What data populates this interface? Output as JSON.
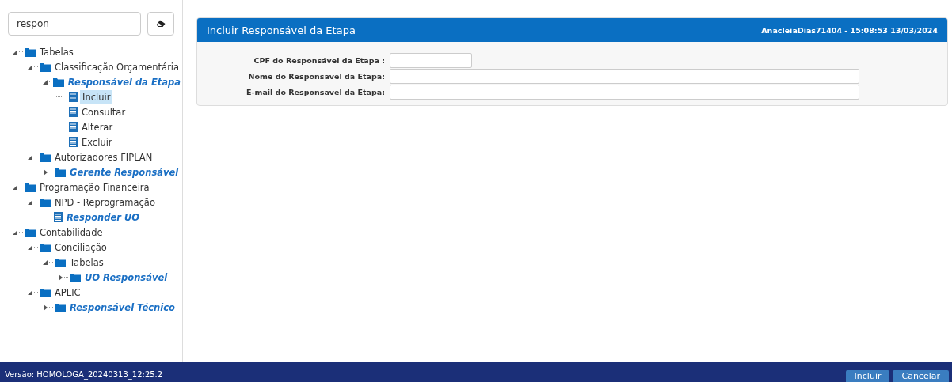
{
  "sidebar": {
    "search": {
      "value": "respon"
    },
    "tree": [
      {
        "label": "Tabelas",
        "kind": "folder",
        "expanded": true,
        "match": false,
        "selected": false,
        "children": [
          {
            "label": "Classificação Orçamentária",
            "kind": "folder",
            "expanded": true,
            "match": false,
            "selected": false,
            "children": [
              {
                "label": "Responsável da Etapa",
                "kind": "folder",
                "expanded": true,
                "match": true,
                "selected": false,
                "children": [
                  {
                    "label": "Incluir",
                    "kind": "page",
                    "match": false,
                    "selected": true
                  },
                  {
                    "label": "Consultar",
                    "kind": "page",
                    "match": false,
                    "selected": false
                  },
                  {
                    "label": "Alterar",
                    "kind": "page",
                    "match": false,
                    "selected": false
                  },
                  {
                    "label": "Excluir",
                    "kind": "page",
                    "match": false,
                    "selected": false
                  }
                ]
              }
            ]
          },
          {
            "label": "Autorizadores FIPLAN",
            "kind": "folder",
            "expanded": true,
            "match": false,
            "selected": false,
            "children": [
              {
                "label": "Gerente Responsável",
                "kind": "folder",
                "expanded": false,
                "match": true,
                "selected": false
              }
            ]
          }
        ]
      },
      {
        "label": "Programação Financeira",
        "kind": "folder",
        "expanded": true,
        "match": false,
        "selected": false,
        "children": [
          {
            "label": "NPD - Reprogramação",
            "kind": "folder",
            "expanded": true,
            "match": false,
            "selected": false,
            "children": [
              {
                "label": "Responder UO",
                "kind": "page",
                "match": true,
                "selected": false
              }
            ]
          }
        ]
      },
      {
        "label": "Contabilidade",
        "kind": "folder",
        "expanded": true,
        "match": false,
        "selected": false,
        "children": [
          {
            "label": "Conciliação",
            "kind": "folder",
            "expanded": true,
            "match": false,
            "selected": false,
            "children": [
              {
                "label": "Tabelas",
                "kind": "folder",
                "expanded": true,
                "match": false,
                "selected": false,
                "children": [
                  {
                    "label": "UO Responsável",
                    "kind": "folder",
                    "expanded": false,
                    "match": true,
                    "selected": false
                  }
                ]
              }
            ]
          },
          {
            "label": "APLIC",
            "kind": "folder",
            "expanded": true,
            "match": false,
            "selected": false,
            "children": [
              {
                "label": "Responsável Técnico",
                "kind": "folder",
                "expanded": false,
                "match": true,
                "selected": false
              }
            ]
          }
        ]
      }
    ]
  },
  "panel": {
    "title": "Incluir Responsável da Etapa",
    "user_info": "AnacleiaDias71404 - 15:08:53 13/03/2024",
    "fields": [
      {
        "label": "CPF do Responsável da Etapa :",
        "kind": "short"
      },
      {
        "label": "Nome do Responsavel da Etapa:",
        "kind": "long"
      },
      {
        "label": "E-mail do Responsavel da Etapa:",
        "kind": "long"
      }
    ]
  },
  "footer": {
    "version": "Versão: HOMOLOGA_20240313_12:25.2",
    "buttons": [
      "Incluir",
      "Cancelar"
    ]
  }
}
